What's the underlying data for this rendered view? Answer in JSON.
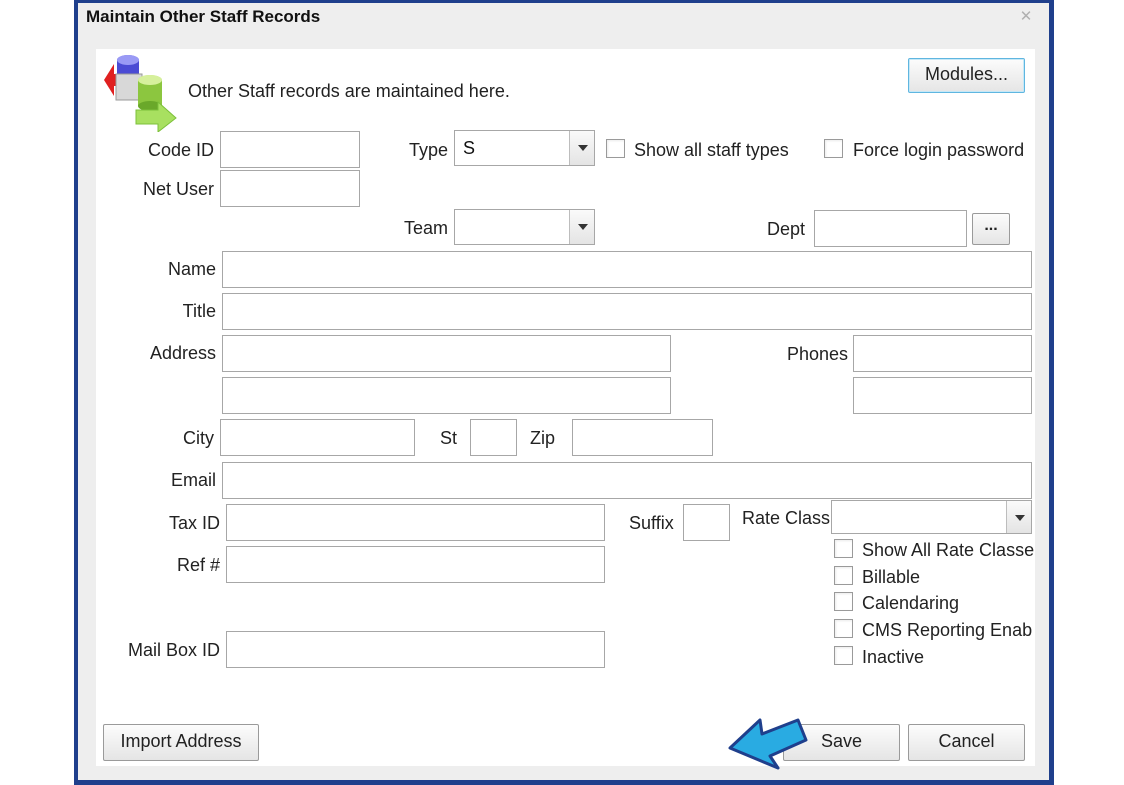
{
  "window": {
    "title": "Maintain Other Staff Records",
    "close_icon": "close-icon"
  },
  "header": {
    "description": "Other Staff records are maintained here.",
    "modules_label": "Modules...",
    "icon": "database-sync-icon"
  },
  "fields": {
    "code_id_label": "Code ID",
    "code_id_value": "",
    "net_user_label": "Net User",
    "net_user_value": "",
    "type_label": "Type",
    "type_value": "S",
    "show_all_staff_types_label": "Show all staff types",
    "force_login_password_label": "Force login password",
    "team_label": "Team",
    "team_value": "",
    "dept_label": "Dept",
    "dept_value": "",
    "dept_browse_label": "...",
    "name_label": "Name",
    "title_label": "Title",
    "address_label": "Address",
    "phones_label": "Phones",
    "city_label": "City",
    "st_label": "St",
    "zip_label": "Zip",
    "email_label": "Email",
    "tax_id_label": "Tax ID",
    "suffix_label": "Suffix",
    "rate_class_label": "Rate Class",
    "rate_class_value": "",
    "ref_label": "Ref #",
    "mail_box_id_label": "Mail Box ID"
  },
  "options": {
    "show_all_rate_classes": "Show All Rate Classe",
    "billable": "Billable",
    "calendaring": "Calendaring",
    "cms_reporting": "CMS Reporting Enab",
    "inactive": "Inactive"
  },
  "footer": {
    "import_address_label": "Import Address",
    "save_label": "Save",
    "cancel_label": "Cancel"
  },
  "annotation": {
    "pointer_arrow_color": "#29abe2",
    "pointer_arrow_stroke": "#1f3f8c"
  }
}
